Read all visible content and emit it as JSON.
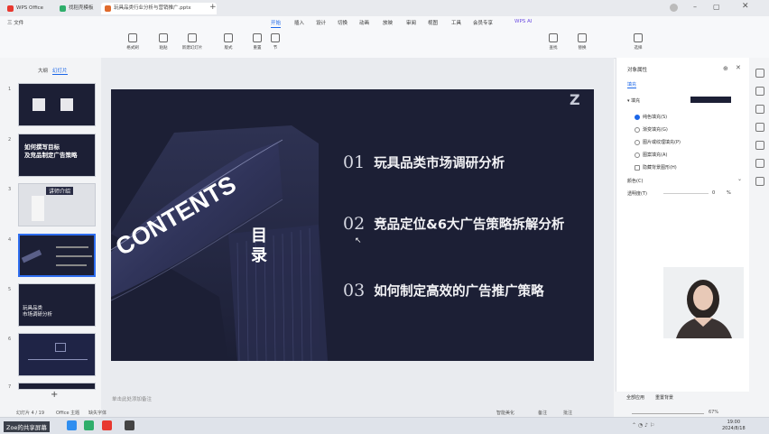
{
  "tabs": [
    {
      "label": "WPS Office"
    },
    {
      "label": "找稻壳模板"
    },
    {
      "label": "玩具品类行业分析与营销推广.pptx"
    }
  ],
  "menu": {
    "file": "三 文件",
    "items": [
      "开始",
      "插入",
      "设计",
      "切换",
      "动画",
      "放映",
      "审阅",
      "视图",
      "工具",
      "会员专享"
    ],
    "active_index": 0,
    "ai": "WPS AI"
  },
  "ribbon": {
    "buttons": [
      "格式刷",
      "粘贴",
      "新建幻灯片",
      "版式",
      "重置",
      "节",
      "查找",
      "替换",
      "选择"
    ]
  },
  "left_panel": {
    "tab_outline": "大纲",
    "tab_slides": "幻灯片",
    "slide_numbers": [
      "1",
      "2",
      "3",
      "4",
      "5",
      "6",
      "7"
    ],
    "slide2_title": "如何撰写目标\n及竞品制定广告策略",
    "slide3_title": "讲师介绍",
    "slide5_title": "玩具品类\n市场调研分析",
    "add_label": "+"
  },
  "slide": {
    "contents_word": "CONTENTS",
    "vertical_title": "目录",
    "logo": "Z",
    "items": [
      {
        "num": "01",
        "text": "玩具品类市场调研分析"
      },
      {
        "num": "02",
        "text": "竞品定位&6大广告策略拆解分析"
      },
      {
        "num": "03",
        "text": "如何制定高效的广告推广策略"
      }
    ]
  },
  "notes_placeholder": "单击此处添加备注",
  "right_panel": {
    "title": "对象属性",
    "tab": "填充",
    "section": "填充",
    "options": [
      "纯色填充(S)",
      "渐变填充(G)",
      "图片或纹理填充(P)",
      "图案填充(A)",
      "隐藏背景图形(H)"
    ],
    "color_label": "颜色(C)",
    "transparency_label": "透明度(T)",
    "transparency_value": "0",
    "transparency_unit": "%",
    "fill_color": "#1c1f35",
    "apply_all": "全部应用",
    "reset_bg": "重置背景"
  },
  "status": {
    "slide_info": "幻灯片 4 / 19",
    "theme": "Office 主题",
    "missing_font": "缺失字体",
    "smart_beautify": "智能美化",
    "notes": "备注",
    "comments": "批注",
    "zoom": "67%"
  },
  "taskbar": {
    "share_label": "Zoe的共享屏幕",
    "time": "19:00",
    "date": "2024/8/18"
  },
  "colors": {
    "accent": "#1b66e8",
    "slide_bg": "#1c1f35"
  }
}
